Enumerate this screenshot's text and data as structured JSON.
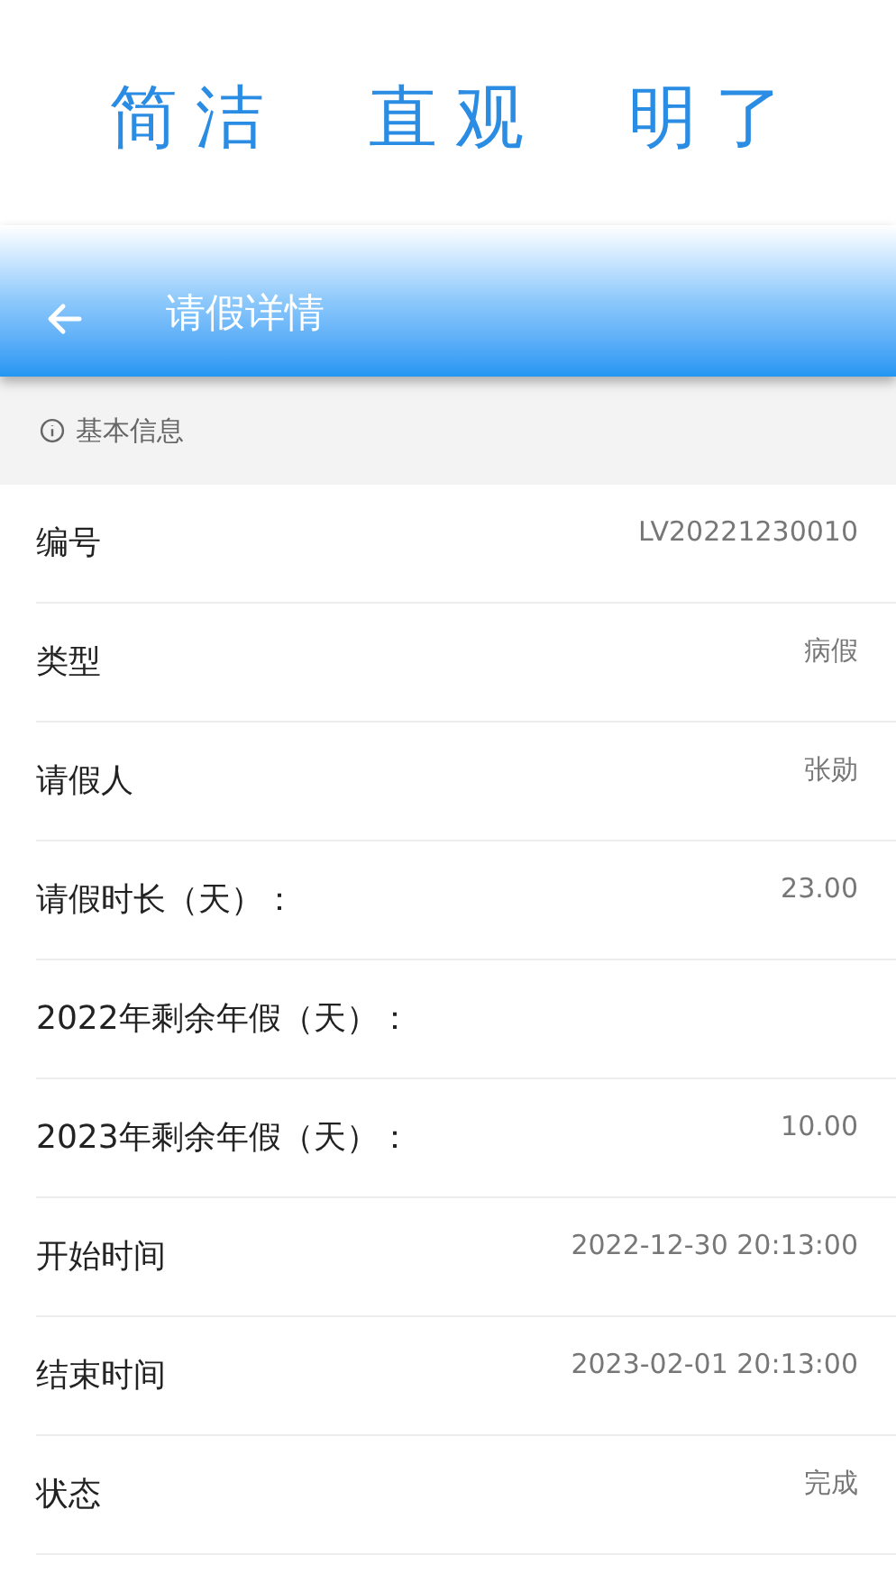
{
  "slogan": [
    "简洁",
    "直观",
    "明了"
  ],
  "header": {
    "title": "请假详情"
  },
  "section": {
    "title": "基本信息"
  },
  "fields": [
    {
      "label": "编号",
      "value": "LV20221230010"
    },
    {
      "label": "类型",
      "value": "病假"
    },
    {
      "label": "请假人",
      "value": "张勋"
    },
    {
      "label": "请假时长（天）：",
      "value": "23.00"
    },
    {
      "label": "2022年剩余年假（天）："
    },
    {
      "label": "2023年剩余年假（天）：",
      "value": "10.00"
    },
    {
      "label": "开始时间",
      "value": "2022-12-30 20:13:00"
    },
    {
      "label": "结束时间",
      "value": "2023-02-01 20:13:00"
    },
    {
      "label": "状态",
      "value": "完成"
    }
  ]
}
